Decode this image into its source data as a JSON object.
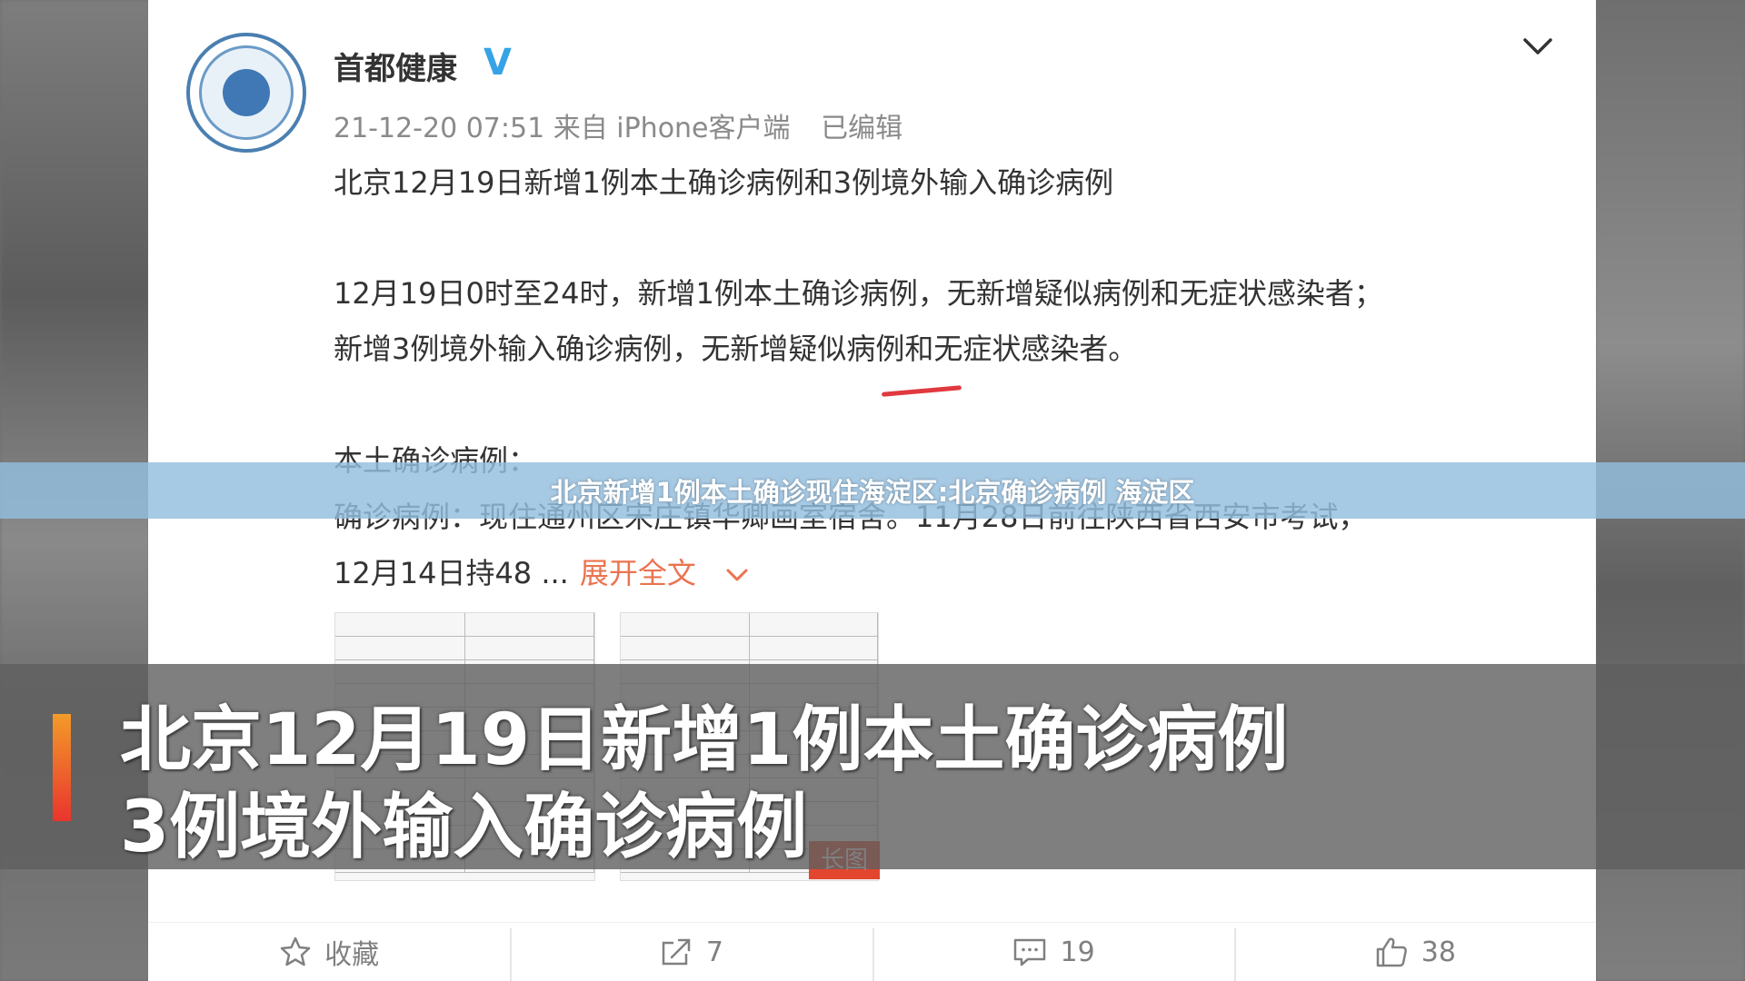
{
  "post": {
    "author": "首都健康",
    "verified_mark": "V",
    "timestamp": "21-12-20 07:51",
    "source": "来自 iPhone客户端",
    "edited": "已编辑",
    "title_line": "北京12月19日新增1例本土确诊病例和3例境外输入确诊病例",
    "body_line1": "12月19日0时至24时，新增1例本土确诊病例，无新增疑似病例和无症状感染者；",
    "body_line2": "新增3例境外输入确诊病例，无新增疑似病例和无症状感染者。",
    "body_line3": "本土确诊病例：",
    "body_line4": "确诊病例：现住通州区宋庄镇华卿画室宿舍。11月28日前往陕西省西安市考试，",
    "body_line5": "12月14日持48 ...",
    "expand_label": "展开全文",
    "long_image_badge": "长图"
  },
  "actions": {
    "favorite_label": "收藏",
    "repost_count": "7",
    "comment_count": "19",
    "like_count": "38"
  },
  "overlay": {
    "headline": "北京新增1例本土确诊现住海淀区:北京确诊病例 海淀区",
    "caption_line1": "北京12月19日新增1例本土确诊病例",
    "caption_line2": "3例境外输入确诊病例"
  },
  "icons": {
    "more": "chevron-down-icon",
    "favorite": "star-icon",
    "repost": "share-icon",
    "comment": "comment-icon",
    "like": "thumbs-up-icon"
  },
  "colors": {
    "verified": "#37a3e6",
    "expand": "#eb7350",
    "badge": "#e2462f",
    "accent_top": "#f29b2a",
    "accent_bottom": "#e9352d"
  }
}
